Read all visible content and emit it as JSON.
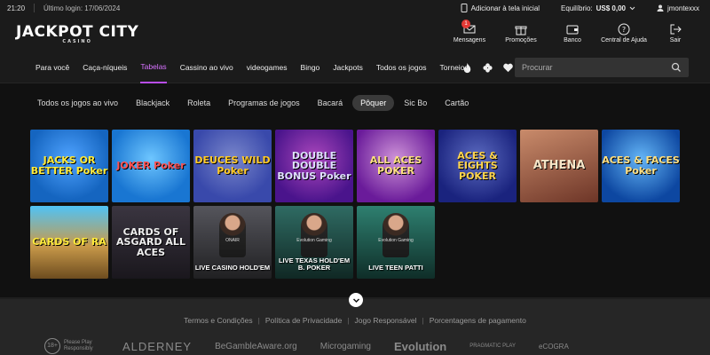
{
  "topbar": {
    "time": "21:20",
    "last_login": "Último login: 17/06/2024",
    "add_home": "Adicionar à tela inicial",
    "balance_label": "Equilíbrio:",
    "balance_value": "US$ 0,00",
    "username": "jmontexxx"
  },
  "header": {
    "logo": "JACKPOT CITY",
    "logo_sub": "CASINO",
    "icons": [
      {
        "label": "Mensagens",
        "badge": "1"
      },
      {
        "label": "Promoções"
      },
      {
        "label": "Banco"
      },
      {
        "label": "Central de Ajuda"
      },
      {
        "label": "Sair"
      }
    ]
  },
  "nav": {
    "links": [
      "Para você",
      "Caça-níqueis",
      "Tabelas",
      "Cassino ao vivo",
      "videogames",
      "Bingo",
      "Jackpots",
      "Todos os jogos",
      "Torneios"
    ],
    "active": "Tabelas",
    "search_placeholder": "Procurar"
  },
  "categories": {
    "items": [
      "Todos os jogos ao vivo",
      "Blackjack",
      "Roleta",
      "Programas de jogos",
      "Bacará",
      "Pôquer",
      "Sic Bo",
      "Cartão"
    ],
    "active": "Pôquer"
  },
  "games": [
    {
      "title": "JACKS OR BETTER Poker",
      "bg": "#1565c0"
    },
    {
      "title": "JOKER Poker",
      "bg": "#1976d2"
    },
    {
      "title": "DEUCES WILD Poker",
      "bg": "#3949ab"
    },
    {
      "title": "DOUBLE DOUBLE BONUS Poker",
      "bg": "#6a1b9a"
    },
    {
      "title": "ALL ACES POKER",
      "bg": "#7b1fa2"
    },
    {
      "title": "ACES & EIGHTS POKER",
      "bg": "#283593"
    },
    {
      "title": "ATHENA",
      "bg": "#8d4b3a"
    },
    {
      "title": "ACES & FACES Poker",
      "bg": "#1e5aa8"
    },
    {
      "title": "CARDS OF RA",
      "bg": "#7a5a2a"
    },
    {
      "title": "CARDS OF ASGARD ALL ACES",
      "bg": "#2e2a33"
    },
    {
      "title": "LIVE CASINO HOLD'EM",
      "provider": "ONAIR",
      "bg": "#3a3a3e",
      "live": true
    },
    {
      "title": "LIVE TEXAS HOLD'EM B. POKER",
      "provider": "Evolution Gaming",
      "bg": "#1f4a44",
      "live": true
    },
    {
      "title": "LIVE TEEN PATTI",
      "provider": "Evolution Gaming",
      "bg": "#1e5a50",
      "live": true
    }
  ],
  "footer": {
    "links": [
      "Termos e Condições",
      "Política de Privacidade",
      "Jogo Responsável",
      "Porcentagens de pagamento"
    ],
    "age": "18+",
    "age_text": "Please Play Responsibly",
    "logos": [
      "ALDERNEY",
      "BeGambleAware.org",
      "Microgaming",
      "Evolution",
      "PRAGMATIC PLAY",
      "eCOGRA"
    ]
  }
}
